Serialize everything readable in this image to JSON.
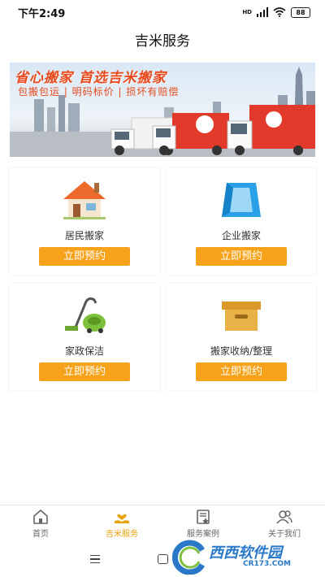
{
  "status_bar": {
    "time": "下午2:49",
    "network": "HD",
    "battery": "88"
  },
  "header": {
    "title": "吉米服务"
  },
  "banner": {
    "headline": "省心搬家 首选吉米搬家",
    "tagline": "包搬包运 | 明码标价 | 损坏有赔偿"
  },
  "services": [
    {
      "label": "居民搬家",
      "button": "立即预约",
      "icon": "house-icon"
    },
    {
      "label": "企业搬家",
      "button": "立即预约",
      "icon": "building-icon"
    },
    {
      "label": "家政保洁",
      "button": "立即预约",
      "icon": "vacuum-cleaner-icon"
    },
    {
      "label": "搬家收纳/整理",
      "button": "立即预约",
      "icon": "storage-box-icon"
    }
  ],
  "tabbar": {
    "items": [
      {
        "label": "首页",
        "icon": "home-icon",
        "active": false
      },
      {
        "label": "吉米服务",
        "icon": "service-hand-icon",
        "active": true
      },
      {
        "label": "服务案例",
        "icon": "case-document-icon",
        "active": false
      },
      {
        "label": "关于我们",
        "icon": "about-us-icon",
        "active": false
      }
    ]
  },
  "watermark": {
    "text": "西西软件园",
    "domain": "CR173.COM"
  },
  "colors": {
    "accent": "#f7a21b",
    "active_tab": "#e8a20c",
    "banner_text": "#e84a1d"
  }
}
